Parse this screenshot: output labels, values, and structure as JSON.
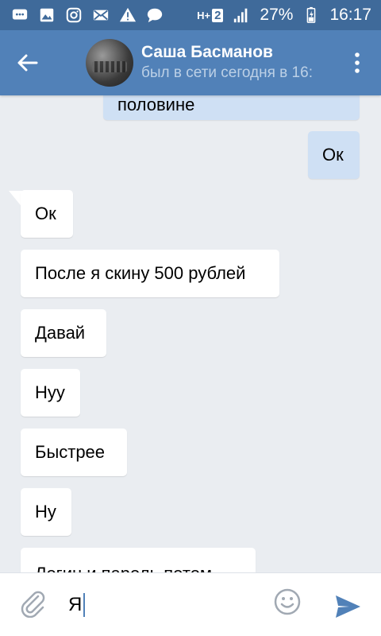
{
  "status_bar": {
    "network_label": "H+",
    "sim_number": "2",
    "battery": "27%",
    "time": "16:17",
    "icons": [
      "chat-icon",
      "gallery-icon",
      "instagram-icon",
      "mail-icon",
      "warning-icon",
      "message-icon",
      "signal-icon",
      "battery-icon"
    ]
  },
  "header": {
    "contact_name": "Саша Басманов",
    "contact_status": "был в сети сегодня в 16:",
    "accent_color": "#5181b8"
  },
  "messages": [
    {
      "direction": "out",
      "text": "половине"
    },
    {
      "direction": "out",
      "text": "Ок"
    },
    {
      "direction": "in",
      "text": "Ок"
    },
    {
      "direction": "in",
      "text": "После я скину 500 рублей"
    },
    {
      "direction": "in",
      "text": "Давай"
    },
    {
      "direction": "in",
      "text": "Нуу"
    },
    {
      "direction": "in",
      "text": "Быстрее"
    },
    {
      "direction": "in",
      "text": "Ну"
    },
    {
      "direction": "in",
      "text": "Логин и пароль потом"
    }
  ],
  "composer": {
    "input_value": "Я",
    "icons": [
      "paperclip-icon",
      "emoji-icon",
      "send-icon"
    ]
  }
}
